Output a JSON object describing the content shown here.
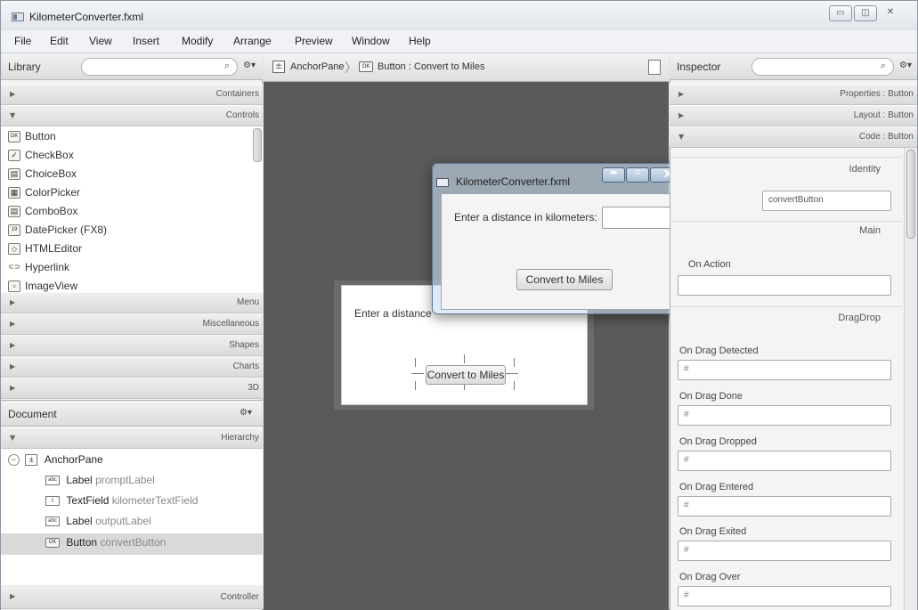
{
  "window": {
    "title": "KilometerConverter.fxml",
    "controls": {
      "minimize": "▭",
      "maximize": "◫",
      "close": "✕"
    }
  },
  "menubar": [
    "File",
    "Edit",
    "View",
    "Insert",
    "Modify",
    "Arrange",
    "Preview",
    "Window",
    "Help"
  ],
  "library": {
    "title": "Library",
    "search_placeholder": "",
    "sections": {
      "containers": "Containers",
      "controls": "Controls",
      "menu": "Menu",
      "miscellaneous": "Miscellaneous",
      "shapes": "Shapes",
      "charts": "Charts",
      "three_d": "3D"
    },
    "controls_items": [
      {
        "icon": "OK",
        "label": "Button"
      },
      {
        "icon": "✓",
        "label": "CheckBox"
      },
      {
        "icon": "▤",
        "label": "ChoiceBox"
      },
      {
        "icon": "▦",
        "label": "ColorPicker"
      },
      {
        "icon": "▤",
        "label": "ComboBox"
      },
      {
        "icon": "19",
        "label": "DatePicker  (FX8)"
      },
      {
        "icon": "◇",
        "label": "HTMLEditor"
      },
      {
        "icon": "⊂⊃",
        "label": "Hyperlink"
      },
      {
        "icon": "▫",
        "label": "ImageView"
      }
    ]
  },
  "document": {
    "title": "Document",
    "settings_icon": "⚙▾",
    "hierarchy_label": "Hierarchy",
    "controller_label": "Controller",
    "root": {
      "type": "AnchorPane"
    },
    "children": [
      {
        "icon": "abc",
        "type": "Label",
        "fx_id": "promptLabel"
      },
      {
        "icon": "I",
        "type": "TextField",
        "fx_id": "kilometerTextField"
      },
      {
        "icon": "abc",
        "type": "Label",
        "fx_id": "outputLabel"
      },
      {
        "icon": "OK",
        "type": "Button",
        "fx_id": "convertButton"
      }
    ]
  },
  "breadcrumb": {
    "root": "AnchorPane",
    "current": "Button : Convert to Miles"
  },
  "design": {
    "prompt_text": "Enter a distance",
    "button_text": "Convert to Miles"
  },
  "preview": {
    "title": "KilometerConverter.fxml",
    "prompt": "Enter a distance in kilometers:",
    "input_value": "",
    "button": "Convert to Miles"
  },
  "inspector": {
    "title": "Inspector",
    "sections": {
      "properties": "Properties : Button",
      "layout": "Layout : Button",
      "code": "Code : Button"
    },
    "identity_heading": "Identity",
    "fx_id_value": "convertButton",
    "main_heading": "Main",
    "on_action_label": "On Action",
    "dragdrop_heading": "DragDrop",
    "hash": "#",
    "events": [
      "On Drag Detected",
      "On Drag Done",
      "On Drag Dropped",
      "On Drag Entered",
      "On Drag Exited",
      "On Drag Over"
    ]
  }
}
